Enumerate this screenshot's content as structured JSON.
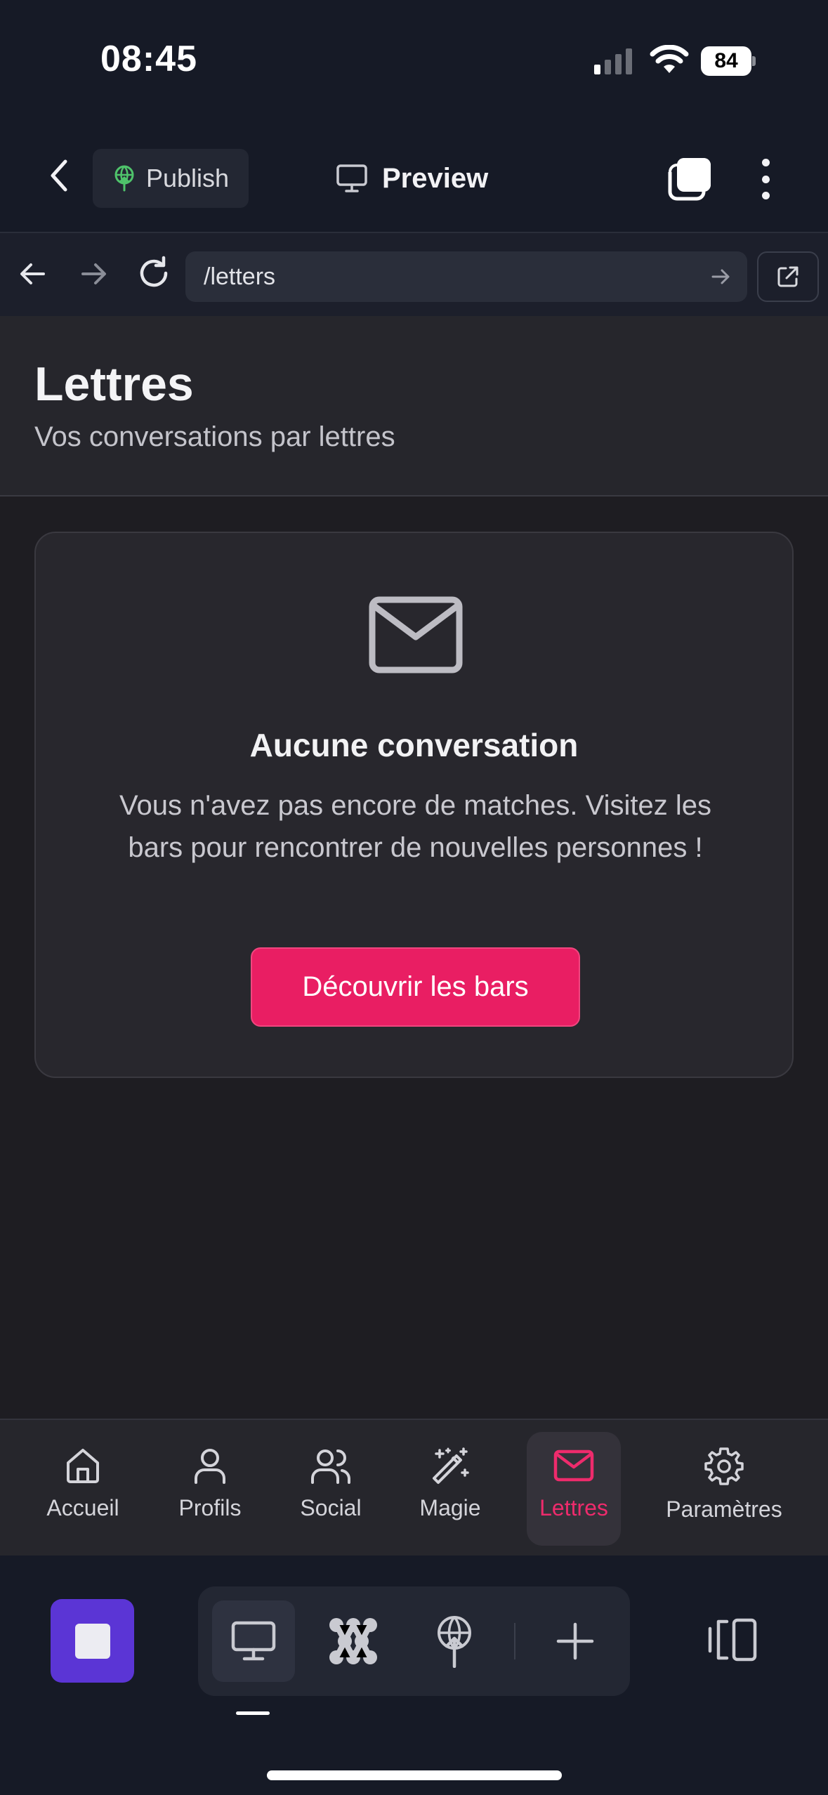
{
  "status_bar": {
    "time": "08:45",
    "battery": "84"
  },
  "toolbar": {
    "publish_label": "Publish",
    "preview_label": "Preview"
  },
  "browser": {
    "url": "/letters"
  },
  "page": {
    "title": "Lettres",
    "subtitle": "Vos conversations par lettres"
  },
  "empty_state": {
    "title": "Aucune conversation",
    "description": "Vous n'avez pas encore de matches. Visitez les bars pour rencontrer de nouvelles personnes !",
    "button_label": "Découvrir les bars"
  },
  "tab_nav": {
    "active": "Lettres",
    "accent_color": "#ee2b6c",
    "items": [
      {
        "label": "Accueil",
        "icon": "home-icon"
      },
      {
        "label": "Profils",
        "icon": "user-icon"
      },
      {
        "label": "Social",
        "icon": "users-icon"
      },
      {
        "label": "Magie",
        "icon": "magic-wand-icon"
      },
      {
        "label": "Lettres",
        "icon": "mail-icon"
      },
      {
        "label": "Paramètres",
        "icon": "settings-gear-icon"
      }
    ]
  },
  "dev_bar": {
    "stop_color": "#5b35d5",
    "tools": [
      "monitor-icon",
      "cluster-icon",
      "publish-globe-icon",
      "plus-icon"
    ]
  }
}
